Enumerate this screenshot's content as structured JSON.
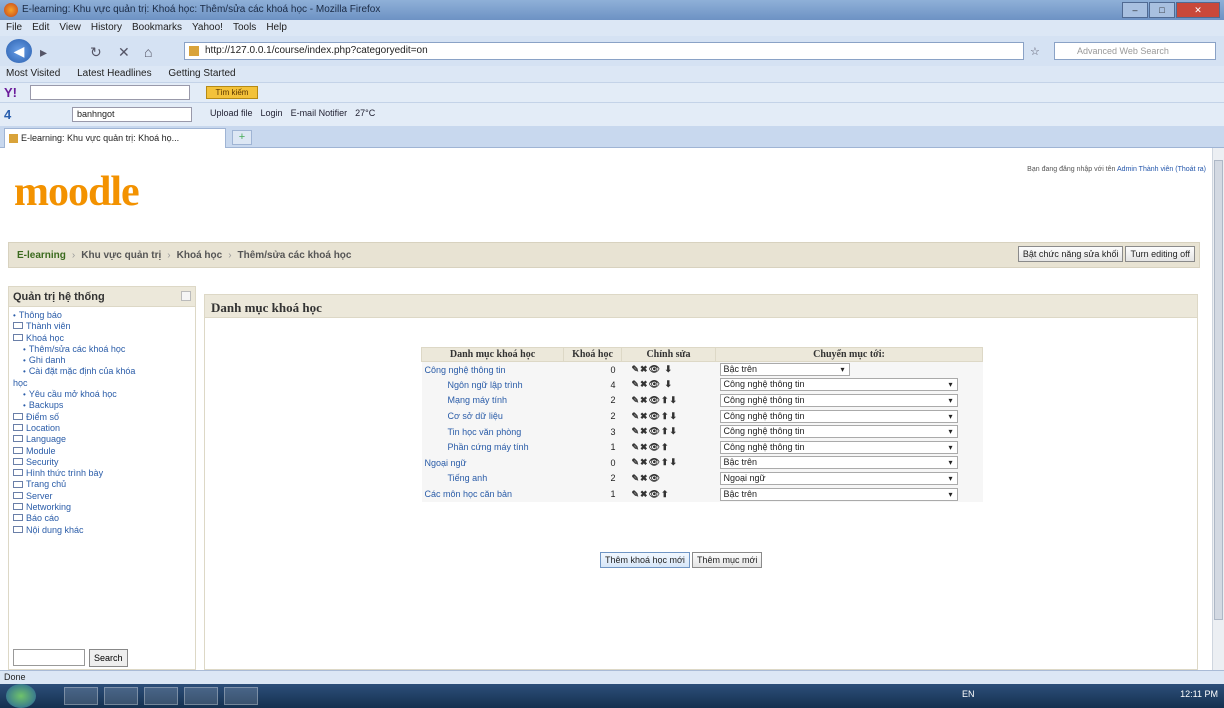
{
  "window": {
    "title": "E-learning: Khu vực quản trị: Khoá học: Thêm/sửa các khoá học - Mozilla Firefox"
  },
  "menu": [
    "File",
    "Edit",
    "View",
    "History",
    "Bookmarks",
    "Yahoo!",
    "Tools",
    "Help"
  ],
  "nav": {
    "url": "http://127.0.0.1/course/index.php?categoryedit=on",
    "search_placeholder": "Advanced Web Search"
  },
  "bookmarks": [
    "Most Visited",
    "Latest Headlines",
    "Getting Started"
  ],
  "toolbar2": {
    "logo": "4",
    "combo_value": "banhngot",
    "items": [
      "Upload file",
      "Login",
      "E-mail Notifier",
      "27°C"
    ]
  },
  "tab": {
    "label": "E-learning: Khu vực quản trị: Khoá họ..."
  },
  "moodle": {
    "logo": "moodle",
    "login_prefix": "Bạn đang đăng nhập với tên",
    "login_user": "Admin Thành viên",
    "logout": "(Thoát ra)",
    "breadcrumb": [
      "E-learning",
      "Khu vực quản trị",
      "Khoá học",
      "Thêm/sửa các khoá học"
    ],
    "btn_block_edit": "Bật chức năng sửa khối",
    "btn_turn_editing_off": "Turn editing off"
  },
  "sidebar": {
    "title": "Quản trị hệ thống",
    "items": [
      {
        "label": "Thông báo",
        "type": "bullet",
        "level": 0
      },
      {
        "label": "Thành viên",
        "type": "folder",
        "level": 0
      },
      {
        "label": "Khoá học",
        "type": "folder",
        "level": 0
      },
      {
        "label": "Thêm/sửa các khoá học",
        "type": "bullet",
        "level": 1
      },
      {
        "label": "Ghi danh",
        "type": "bullet",
        "level": 1
      },
      {
        "label": "Cài đặt mặc định của khóa",
        "type": "bullet",
        "level": 1
      },
      {
        "label": "học",
        "type": "none",
        "level": 0
      },
      {
        "label": "Yêu cầu mở khoá học",
        "type": "bullet",
        "level": 1
      },
      {
        "label": "Backups",
        "type": "bullet",
        "level": 1
      },
      {
        "label": "Điểm số",
        "type": "folder",
        "level": 0
      },
      {
        "label": "Location",
        "type": "folder",
        "level": 0
      },
      {
        "label": "Language",
        "type": "folder",
        "level": 0
      },
      {
        "label": "Module",
        "type": "folder",
        "level": 0
      },
      {
        "label": "Security",
        "type": "folder",
        "level": 0
      },
      {
        "label": "Hình thức trình bày",
        "type": "folder",
        "level": 0
      },
      {
        "label": "Trang chủ",
        "type": "folder",
        "level": 0
      },
      {
        "label": "Server",
        "type": "folder",
        "level": 0
      },
      {
        "label": "Networking",
        "type": "folder",
        "level": 0
      },
      {
        "label": "Báo cáo",
        "type": "folder",
        "level": 0
      },
      {
        "label": "Nội dung khác",
        "type": "folder",
        "level": 0
      }
    ],
    "search_button": "Search"
  },
  "main": {
    "heading": "Danh mục khoá học",
    "columns": [
      "Danh mục khoá học",
      "Khoá học",
      "Chỉnh sửa",
      "Chuyển mục tới:"
    ],
    "rows": [
      {
        "name": "Công nghệ thông tin",
        "count": "0",
        "edit": "✎✖👁 ⬇",
        "move": "Bậc trên",
        "indent": 0
      },
      {
        "name": "Ngôn ngữ lập trình",
        "count": "4",
        "edit": "✎✖👁 ⬇",
        "move": "Công nghệ thông tin",
        "indent": 1
      },
      {
        "name": "Mạng máy tính",
        "count": "2",
        "edit": "✎✖👁⬆⬇",
        "move": "Công nghệ thông tin",
        "indent": 1
      },
      {
        "name": "Cơ sở dữ liệu",
        "count": "2",
        "edit": "✎✖👁⬆⬇",
        "move": "Công nghệ thông tin",
        "indent": 1
      },
      {
        "name": "Tin học văn phòng",
        "count": "3",
        "edit": "✎✖👁⬆⬇",
        "move": "Công nghệ thông tin",
        "indent": 1
      },
      {
        "name": "Phần cứng máy tính",
        "count": "1",
        "edit": "✎✖👁⬆",
        "move": "Công nghệ thông tin",
        "indent": 1
      },
      {
        "name": "Ngoại ngữ",
        "count": "0",
        "edit": "✎✖👁⬆⬇",
        "move": "Bậc trên",
        "indent": 0
      },
      {
        "name": "Tiếng anh",
        "count": "2",
        "edit": "✎✖👁",
        "move": "Ngoại ngữ",
        "indent": 1
      },
      {
        "name": "Các môn học căn bản",
        "count": "1",
        "edit": "✎✖👁⬆",
        "move": "Bậc trên",
        "indent": 0
      }
    ],
    "btn_add_course": "Thêm khoá học mới",
    "btn_add_category": "Thêm mục mới"
  },
  "status": "Done",
  "taskbar": {
    "lang": "EN",
    "clock": "12:11 PM"
  }
}
